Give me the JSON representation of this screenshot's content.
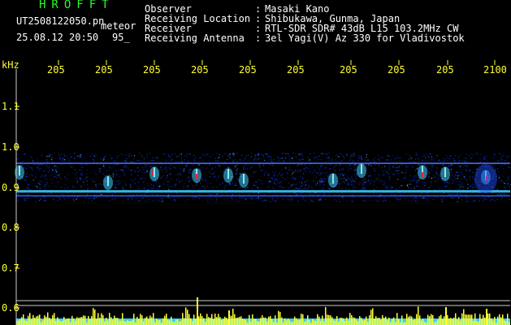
{
  "header": {
    "title": "HROFFT",
    "filename": "UT2508122050.pn",
    "tag": "meteor",
    "datetime": "25.08.12 20:50",
    "count": "95_"
  },
  "info": [
    {
      "label": "Observer",
      "value": "Masaki Kano"
    },
    {
      "label": "Receiving Location",
      "value": "Shibukawa, Gunma, Japan"
    },
    {
      "label": "Receiver",
      "value": "RTL-SDR SDR# 43dB L15 103.2MHz CW"
    },
    {
      "label": "Receiving Antenna",
      "value": "3el Yagi(V) Az 330 for Vladivostok"
    }
  ],
  "axis": {
    "unit": "kHz",
    "time_ticks": [
      "205",
      "205",
      "205",
      "205",
      "205",
      "205",
      "205",
      "205",
      "205",
      "2100"
    ],
    "freq_ticks": [
      "1.1",
      "1.0",
      "0.9",
      "0.8",
      "0.7",
      "0.6"
    ]
  },
  "colors": {
    "text_green": "#22ff22",
    "text_white": "#ffffff",
    "tick_yellow": "#ffff33",
    "background": "#000000",
    "noise_blue": "#1030c0",
    "echo_cyan": "#40d0ff",
    "echo_red": "#ff2040"
  }
}
